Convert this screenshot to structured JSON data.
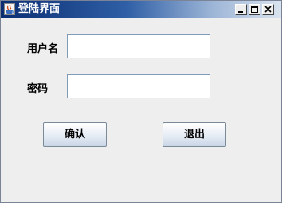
{
  "window": {
    "title": "登陆界面",
    "icons": {
      "app": "java-coffee-icon",
      "minimize": "minimize-icon",
      "maximize": "maximize-icon",
      "close": "close-icon"
    }
  },
  "form": {
    "username_label": "用户名",
    "username_value": "",
    "password_label": "密码",
    "password_value": ""
  },
  "buttons": {
    "confirm": "确认",
    "exit": "退出"
  },
  "colors": {
    "title_start": "#0b2e73",
    "title_end": "#d9e3ef",
    "panel": "#eeeeee",
    "field_border": "#7f9db9"
  }
}
